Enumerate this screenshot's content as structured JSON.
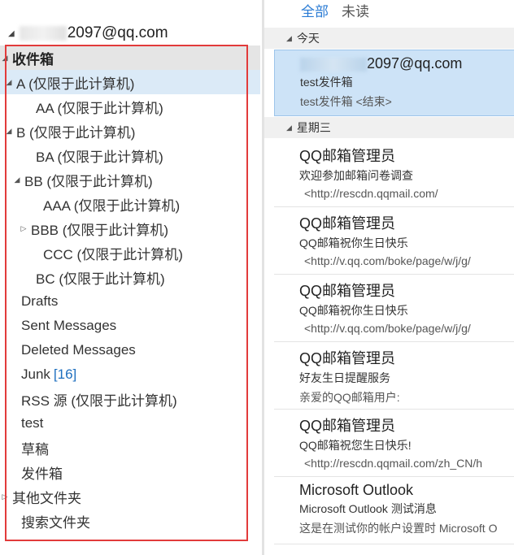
{
  "account": {
    "email_visible": "2097@qq.com"
  },
  "folders": [
    {
      "label": "收件箱",
      "arrow": "◢",
      "indent": 10,
      "style": "inbox bold",
      "top": 0
    },
    {
      "label": "A (仅限于此计算机)",
      "arrow": "◢",
      "indent": 20,
      "style": "sel"
    },
    {
      "label": "AA (仅限于此计算机)",
      "arrow": "",
      "indent": 44
    },
    {
      "label": "B (仅限于此计算机)",
      "arrow": "◢",
      "indent": 20
    },
    {
      "label": "BA (仅限于此计算机)",
      "arrow": "",
      "indent": 44
    },
    {
      "label": "BB (仅限于此计算机)",
      "arrow": "◢",
      "indent": 30
    },
    {
      "label": "AAA (仅限于此计算机)",
      "arrow": "",
      "indent": 53
    },
    {
      "label": "BBB (仅限于此计算机)",
      "arrow": "▷",
      "indent": 38
    },
    {
      "label": "CCC (仅限于此计算机)",
      "arrow": "",
      "indent": 53
    },
    {
      "label": "BC (仅限于此计算机)",
      "arrow": "",
      "indent": 44
    },
    {
      "label": "Drafts",
      "arrow": "",
      "indent": 26
    },
    {
      "label": "Sent Messages",
      "arrow": "",
      "indent": 26
    },
    {
      "label": "Deleted Messages",
      "arrow": "",
      "indent": 26
    },
    {
      "label": "Junk",
      "arrow": "",
      "indent": 26,
      "count": "[16]"
    },
    {
      "label": "RSS 源 (仅限于此计算机)",
      "arrow": "",
      "indent": 26
    },
    {
      "label": "test",
      "arrow": "",
      "indent": 26
    },
    {
      "label": "草稿",
      "arrow": "",
      "indent": 26
    },
    {
      "label": "发件箱",
      "arrow": "",
      "indent": 26
    },
    {
      "label": "其他文件夹",
      "arrow": "▷",
      "indent": 10
    },
    {
      "label": "搜索文件夹",
      "arrow": "",
      "indent": 26
    }
  ],
  "tabs": {
    "all": "全部",
    "unread": "未读"
  },
  "groups": {
    "today": "今天",
    "wednesday": "星期三"
  },
  "messages": [
    {
      "from_visible": "2097@qq.com",
      "subject": "test发件箱",
      "preview": "test发件箱 <结束>",
      "selected": true
    },
    {
      "from": "QQ邮箱管理员",
      "subject": "欢迎参加邮箱问卷调查",
      "preview": "<http://rescdn.qqmail.com/",
      "ind": true
    },
    {
      "from": "QQ邮箱管理员",
      "subject": "QQ邮箱祝你生日快乐",
      "preview": "<http://v.qq.com/boke/page/w/j/g/",
      "ind": true
    },
    {
      "from": "QQ邮箱管理员",
      "subject": "QQ邮箱祝你生日快乐",
      "preview": "<http://v.qq.com/boke/page/w/j/g/",
      "ind": true
    },
    {
      "from": "QQ邮箱管理员",
      "subject": "好友生日提醒服务",
      "preview": "亲爱的QQ邮箱用户:"
    },
    {
      "from": "QQ邮箱管理员",
      "subject": "QQ邮箱祝您生日快乐!",
      "preview": "<http://rescdn.qqmail.com/zh_CN/h",
      "ind": true
    },
    {
      "from": "Microsoft Outlook",
      "subject": "Microsoft Outlook 测试消息",
      "preview": "这是在测试你的帐户设置时 Microsoft O"
    }
  ]
}
